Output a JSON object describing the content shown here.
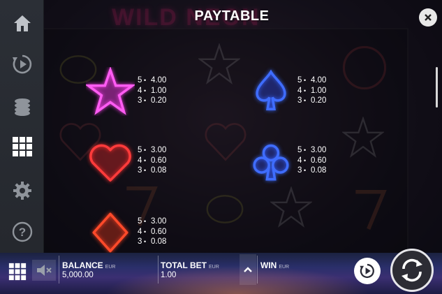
{
  "header": {
    "title": "PAYTABLE"
  },
  "sidebar": {
    "items": [
      {
        "icon": "home-icon"
      },
      {
        "icon": "autoplay-icon"
      },
      {
        "icon": "coins-icon"
      },
      {
        "icon": "paytable-grid-icon",
        "active": true
      },
      {
        "icon": "settings-gear-icon"
      },
      {
        "icon": "help-icon"
      }
    ]
  },
  "paytable": {
    "symbols": [
      {
        "name": "star",
        "color": "#ff3df0",
        "pays": [
          {
            "count": "5",
            "value": "4.00"
          },
          {
            "count": "4",
            "value": "1.00"
          },
          {
            "count": "3",
            "value": "0.20"
          }
        ]
      },
      {
        "name": "spade",
        "color": "#3a6bff",
        "pays": [
          {
            "count": "5",
            "value": "4.00"
          },
          {
            "count": "4",
            "value": "1.00"
          },
          {
            "count": "3",
            "value": "0.20"
          }
        ]
      },
      {
        "name": "heart",
        "color": "#ff3030",
        "pays": [
          {
            "count": "5",
            "value": "3.00"
          },
          {
            "count": "4",
            "value": "0.60"
          },
          {
            "count": "3",
            "value": "0.08"
          }
        ]
      },
      {
        "name": "club",
        "color": "#3a6bff",
        "pays": [
          {
            "count": "5",
            "value": "3.00"
          },
          {
            "count": "4",
            "value": "0.60"
          },
          {
            "count": "3",
            "value": "0.08"
          }
        ]
      },
      {
        "name": "diamond",
        "color": "#ff4020",
        "pays": [
          {
            "count": "5",
            "value": "3.00"
          },
          {
            "count": "4",
            "value": "0.60"
          },
          {
            "count": "3",
            "value": "0.08"
          }
        ]
      }
    ],
    "bullet": "•"
  },
  "bottombar": {
    "balance_label": "BALANCE",
    "balance_currency": "EUR",
    "balance_value": "5,000.00",
    "totalbet_label": "TOTAL BET",
    "totalbet_currency": "EUR",
    "totalbet_value": "1.00",
    "win_label": "WIN",
    "win_currency": "EUR"
  },
  "background": {
    "logo_text": "WILD NEON"
  }
}
